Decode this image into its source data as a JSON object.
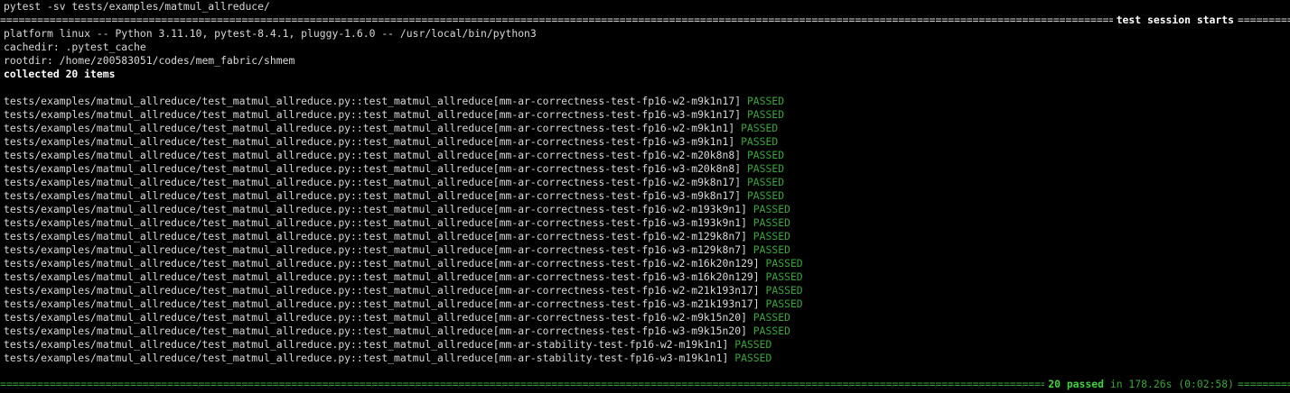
{
  "command": "pytest -sv tests/examples/matmul_allreduce/",
  "session_title": "test session starts",
  "platform_line": "platform linux -- Python 3.11.10, pytest-8.4.1, pluggy-1.6.0 -- /usr/local/bin/python3",
  "cachedir_line": "cachedir: .pytest_cache",
  "rootdir_line": "rootdir: /home/z00583051/codes/mem_fabric/shmem",
  "collected_line": "collected 20 items",
  "tests": [
    {
      "name": "tests/examples/matmul_allreduce/test_matmul_allreduce.py::test_matmul_allreduce[mm-ar-correctness-test-fp16-w2-m9k1n17]",
      "status": "PASSED"
    },
    {
      "name": "tests/examples/matmul_allreduce/test_matmul_allreduce.py::test_matmul_allreduce[mm-ar-correctness-test-fp16-w3-m9k1n17]",
      "status": "PASSED"
    },
    {
      "name": "tests/examples/matmul_allreduce/test_matmul_allreduce.py::test_matmul_allreduce[mm-ar-correctness-test-fp16-w2-m9k1n1]",
      "status": "PASSED"
    },
    {
      "name": "tests/examples/matmul_allreduce/test_matmul_allreduce.py::test_matmul_allreduce[mm-ar-correctness-test-fp16-w3-m9k1n1]",
      "status": "PASSED"
    },
    {
      "name": "tests/examples/matmul_allreduce/test_matmul_allreduce.py::test_matmul_allreduce[mm-ar-correctness-test-fp16-w2-m20k8n8]",
      "status": "PASSED"
    },
    {
      "name": "tests/examples/matmul_allreduce/test_matmul_allreduce.py::test_matmul_allreduce[mm-ar-correctness-test-fp16-w3-m20k8n8]",
      "status": "PASSED"
    },
    {
      "name": "tests/examples/matmul_allreduce/test_matmul_allreduce.py::test_matmul_allreduce[mm-ar-correctness-test-fp16-w2-m9k8n17]",
      "status": "PASSED"
    },
    {
      "name": "tests/examples/matmul_allreduce/test_matmul_allreduce.py::test_matmul_allreduce[mm-ar-correctness-test-fp16-w3-m9k8n17]",
      "status": "PASSED"
    },
    {
      "name": "tests/examples/matmul_allreduce/test_matmul_allreduce.py::test_matmul_allreduce[mm-ar-correctness-test-fp16-w2-m193k9n1]",
      "status": "PASSED"
    },
    {
      "name": "tests/examples/matmul_allreduce/test_matmul_allreduce.py::test_matmul_allreduce[mm-ar-correctness-test-fp16-w3-m193k9n1]",
      "status": "PASSED"
    },
    {
      "name": "tests/examples/matmul_allreduce/test_matmul_allreduce.py::test_matmul_allreduce[mm-ar-correctness-test-fp16-w2-m129k8n7]",
      "status": "PASSED"
    },
    {
      "name": "tests/examples/matmul_allreduce/test_matmul_allreduce.py::test_matmul_allreduce[mm-ar-correctness-test-fp16-w3-m129k8n7]",
      "status": "PASSED"
    },
    {
      "name": "tests/examples/matmul_allreduce/test_matmul_allreduce.py::test_matmul_allreduce[mm-ar-correctness-test-fp16-w2-m16k20n129]",
      "status": "PASSED"
    },
    {
      "name": "tests/examples/matmul_allreduce/test_matmul_allreduce.py::test_matmul_allreduce[mm-ar-correctness-test-fp16-w3-m16k20n129]",
      "status": "PASSED"
    },
    {
      "name": "tests/examples/matmul_allreduce/test_matmul_allreduce.py::test_matmul_allreduce[mm-ar-correctness-test-fp16-w2-m21k193n17]",
      "status": "PASSED"
    },
    {
      "name": "tests/examples/matmul_allreduce/test_matmul_allreduce.py::test_matmul_allreduce[mm-ar-correctness-test-fp16-w3-m21k193n17]",
      "status": "PASSED"
    },
    {
      "name": "tests/examples/matmul_allreduce/test_matmul_allreduce.py::test_matmul_allreduce[mm-ar-correctness-test-fp16-w2-m9k15n20]",
      "status": "PASSED"
    },
    {
      "name": "tests/examples/matmul_allreduce/test_matmul_allreduce.py::test_matmul_allreduce[mm-ar-correctness-test-fp16-w3-m9k15n20]",
      "status": "PASSED"
    },
    {
      "name": "tests/examples/matmul_allreduce/test_matmul_allreduce.py::test_matmul_allreduce[mm-ar-stability-test-fp16-w2-m19k1n1]",
      "status": "PASSED"
    },
    {
      "name": "tests/examples/matmul_allreduce/test_matmul_allreduce.py::test_matmul_allreduce[mm-ar-stability-test-fp16-w3-m19k1n1]",
      "status": "PASSED"
    }
  ],
  "summary": {
    "passed": "20 passed",
    "duration": "in 178.26s (0:02:58)"
  },
  "colors": {
    "background": "#000000",
    "text": "#d8d8d8",
    "passed": "#3aa63a",
    "summary_passed": "#3fd33f"
  }
}
